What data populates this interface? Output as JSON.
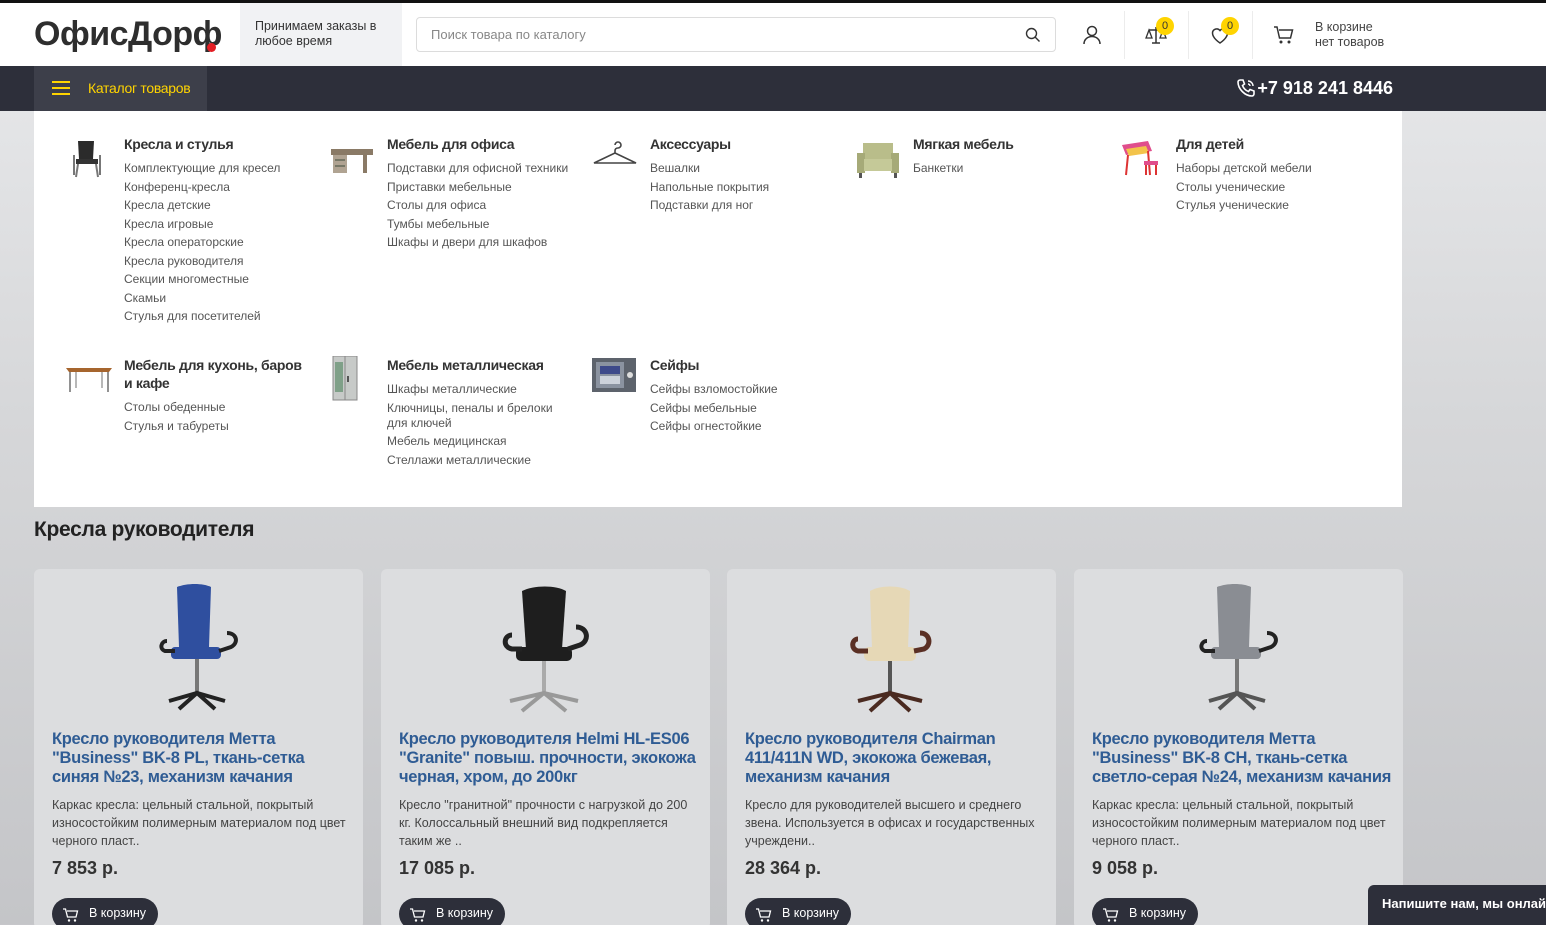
{
  "header": {
    "logo": "ОфисДорф",
    "promo_line1": "Принимаем заказы в",
    "promo_line2": "любое время",
    "search_placeholder": "Поиск товара по каталогу",
    "compare_count": "0",
    "favorites_count": "0",
    "cart_line1": "В корзине",
    "cart_line2": "нет товаров"
  },
  "nav": {
    "catalog_label": "Каталог товаров",
    "phone": "+7 918 241 8446"
  },
  "menu": {
    "categories": [
      {
        "title": "Кресла и стулья",
        "icon": "office-chair-icon",
        "items": [
          "Комплектующие для кресел",
          "Конференц-кресла",
          "Кресла детские",
          "Кресла игровые",
          "Кресла операторские",
          "Кресла руководителя",
          "Секции многоместные",
          "Скамьи",
          "Стулья для посетителей"
        ]
      },
      {
        "title": "Мебель для офиса",
        "icon": "office-desk-icon",
        "items": [
          "Подставки для офисной техники",
          "Приставки мебельные",
          "Столы для офиса",
          "Тумбы мебельные",
          "Шкафы и двери для шкафов"
        ]
      },
      {
        "title": "Аксессуары",
        "icon": "hanger-icon",
        "items": [
          "Вешалки",
          "Напольные покрытия",
          "Подставки для ног"
        ]
      },
      {
        "title": "Мягкая мебель",
        "icon": "armchair-icon",
        "items": [
          "Банкетки"
        ]
      },
      {
        "title": "Для детей",
        "icon": "kids-desk-icon",
        "items": [
          "Наборы детской мебели",
          "Столы ученические",
          "Стулья ученические"
        ]
      },
      {
        "title": "Мебель для кухонь, баров и кафе",
        "icon": "dining-table-icon",
        "items": [
          "Столы обеденные",
          "Стулья и табуреты"
        ]
      },
      {
        "title": "Мебель металлическая",
        "icon": "metal-cabinet-icon",
        "items": [
          "Шкафы металлические",
          "Ключницы, пеналы и брелоки для ключей",
          "Мебель медицинская",
          "Стеллажи металлические"
        ]
      },
      {
        "title": "Сейфы",
        "icon": "safe-icon",
        "items": [
          "Сейфы взломостойкие",
          "Сейфы мебельные",
          "Сейфы огнестойкие"
        ]
      }
    ]
  },
  "section": {
    "title": "Кресла руководителя"
  },
  "products": [
    {
      "name": "Кресло руководителя Метта \"Business\" BK-8 PL, ткань-сетка синяя №23, механизм качания",
      "desc": "Каркас кресла: цельный стальной, покрытый износостойким полимерным материалом под цвет черного пласт..",
      "price": "7 853 р.",
      "buy": "В корзину",
      "color": "#2f4f9f"
    },
    {
      "name": "Кресло руководителя Helmi HL-ES06 \"Granite\" повыш. прочности, экокожа черная, хром, до 200кг",
      "desc": "Кресло \"гранитной\" прочности с нагрузкой до 200 кг. Колоссальный внешний вид подкрепляется таким же ..",
      "price": "17 085 р.",
      "buy": "В корзину",
      "color": "#1e1e1e"
    },
    {
      "name": "Кресло руководителя Chairman 411/411N WD, экокожа бежевая, механизм качания",
      "desc": "Кресло для руководителей высшего и среднего звена. Используется в офисах и государственных учреждени..",
      "price": "28 364 р.",
      "buy": "В корзину",
      "color": "#e6d8b6"
    },
    {
      "name": "Кресло руководителя Метта \"Business\" BK-8 CH, ткань-сетка светло-серая №24, механизм качания",
      "desc": "Каркас кресла: цельный стальной, покрытый износостойким полимерным материалом под цвет черного пласт..",
      "price": "9 058 р.",
      "buy": "В корзину",
      "color": "#8a8d93"
    }
  ],
  "chat": {
    "label": "Напишите нам, мы онлайн!"
  }
}
